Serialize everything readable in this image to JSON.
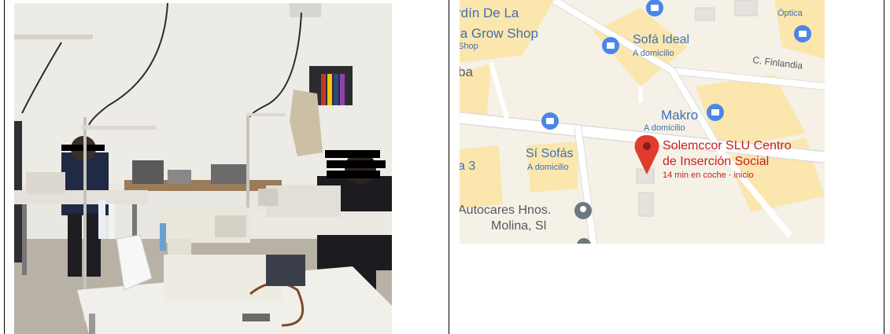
{
  "document": {
    "photo": {
      "description_name": "sewing-workshop-photo"
    },
    "map": {
      "places": [
        {
          "id": "jardin",
          "lines": [
            "rdín De La",
            "ía Grow Shop",
            "Shop"
          ]
        },
        {
          "id": "optica",
          "lines": [
            "Óptica"
          ]
        },
        {
          "id": "sofa-ideal",
          "lines": [
            "Sofá Ideal",
            "A domicilio"
          ]
        },
        {
          "id": "street-finlandia",
          "lines": [
            "C. Finlandia"
          ]
        },
        {
          "id": "ba",
          "lines": [
            "ba"
          ]
        },
        {
          "id": "makro",
          "lines": [
            "Makro",
            "A domicilio"
          ]
        },
        {
          "id": "si-sofas",
          "lines": [
            "Sí Sofás",
            "A domicilio"
          ]
        },
        {
          "id": "a3",
          "lines": [
            "a 3"
          ]
        },
        {
          "id": "solemccor",
          "lines": [
            "Solemccor SLU Centro",
            "de Inserción Social",
            "14 min en coche · inicio"
          ]
        },
        {
          "id": "autocares",
          "lines": [
            "Autocares Hnos.",
            "Molina, Sl"
          ]
        }
      ],
      "colors": {
        "land": "#f5f1e6",
        "block": "#fbe6ad",
        "road": "#ffffff",
        "road_edge": "#dcdcdc",
        "poi_blue": "#4a86e8",
        "poi_gray": "#6e7780",
        "pin_red": "#e03b2f",
        "label_blue": "#3f6fb5",
        "label_red": "#c5221f",
        "label_gray": "#555a5f"
      }
    }
  }
}
